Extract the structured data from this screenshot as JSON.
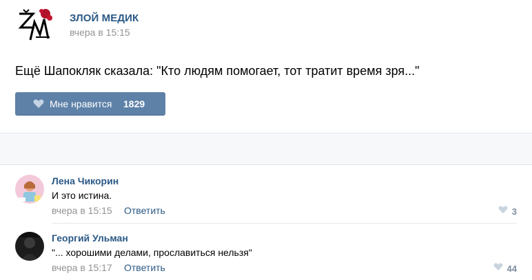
{
  "post": {
    "author": "ЗЛОЙ МЕДИК",
    "date": "вчера в 15:15",
    "text": "Ещё Шапокляк сказала: \"Кто людям помогает, тот тратит время зря...\"",
    "like_label": "Мне нравится",
    "like_count": "1829",
    "logo_icon": "zm-logo-icon"
  },
  "comments": [
    {
      "name": "Лена Чикорин",
      "text": "И это истина.",
      "date": "вчера в 15:15",
      "reply": "Ответить",
      "likes": "3"
    },
    {
      "name": "Георгий Ульман",
      "text": "\"... хорошими делами, прославиться нельзя\"",
      "date": "вчера в 15:17",
      "reply": "Ответить",
      "likes": "44"
    }
  ],
  "colors": {
    "link": "#2a5885",
    "button": "#5e81a8",
    "muted": "#939393"
  }
}
